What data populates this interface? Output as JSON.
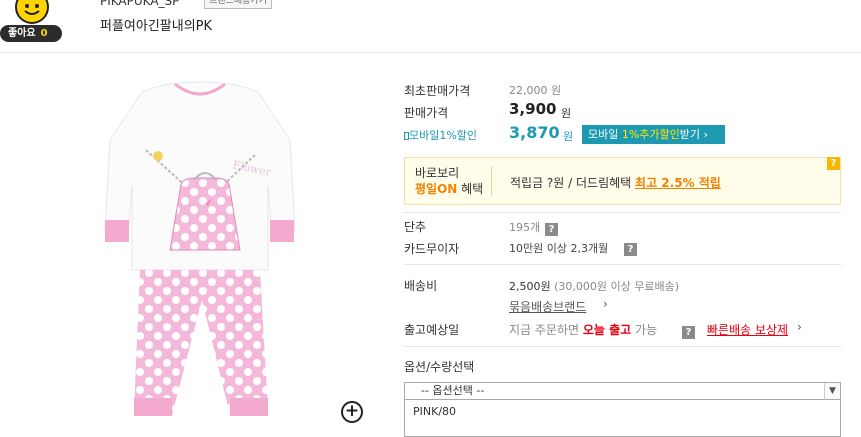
{
  "header": {
    "like_label": "좋아요",
    "like_count": "0",
    "brand_name": "PIKAPUKA_SP",
    "brand_button": "브랜드배송가기",
    "product_title": "퍼플여아긴팔내의PK"
  },
  "price": {
    "original_label": "최초판매가격",
    "original_value": "22,000 원",
    "sale_label": "판매가격",
    "sale_value": "3,900",
    "sale_unit": "원",
    "mobile_label": "모바일1%할인",
    "mobile_value": "3,870",
    "mobile_unit": "원",
    "mobile_button_a": "모바일 ",
    "mobile_button_b": "1%추가할인",
    "mobile_button_c": "받기 ›"
  },
  "benefit": {
    "line1": "바로보리",
    "line2a": "평일ON",
    "line2b": " 혜택",
    "text": "적립금 ?원 / 더드림혜택 ",
    "highlight": "최고 2.5% 적립",
    "help": "?"
  },
  "info": {
    "tancho_label": "단추",
    "tancho_value": "195개",
    "card_label": "카드무이자",
    "card_value": "10만원 이상 2,3개월",
    "ship_label": "배송비",
    "ship_value": "2,500원",
    "ship_note": " (30,000원 이상 무료배송)",
    "bundle_link": "묶음배송브랜드",
    "release_label": "출고예상일",
    "release_pre": "지금 주문하면 ",
    "release_bold": "오늘 출고",
    "release_post": " 가능",
    "fast_link": "빠른배송 보상제"
  },
  "option": {
    "label": "옵션/수량선택",
    "select_value": "-- 옵션선택 --",
    "items": [
      "PINK/80"
    ]
  },
  "colors": {
    "accent": "#1d9ab1",
    "red": "#e60012",
    "orange": "#f08300"
  }
}
